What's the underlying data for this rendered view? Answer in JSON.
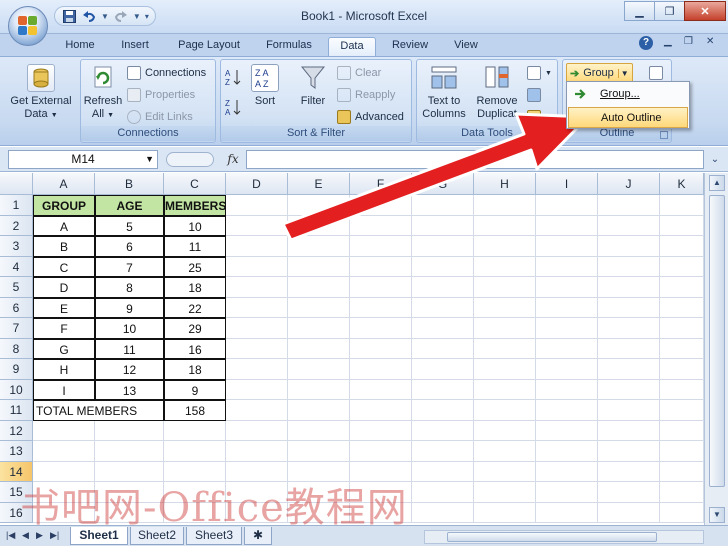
{
  "window": {
    "title": "Book1 - Microsoft Excel"
  },
  "tabs": [
    "Home",
    "Insert",
    "Page Layout",
    "Formulas",
    "Data",
    "Review",
    "View"
  ],
  "active_tab": "Data",
  "ribbon": {
    "get_external_data": {
      "line1": "Get External",
      "line2": "Data"
    },
    "refresh": {
      "line1": "Refresh",
      "line2": "All"
    },
    "connections_items": [
      "Connections",
      "Properties",
      "Edit Links"
    ],
    "connections_group": "Connections",
    "sort": "Sort",
    "filter": "Filter",
    "filter_items": [
      "Clear",
      "Reapply",
      "Advanced"
    ],
    "sort_filter_group": "Sort & Filter",
    "text_to_columns": {
      "line1": "Text to",
      "line2": "Columns"
    },
    "remove_duplicates": {
      "line1": "Remove",
      "line2": "Duplicat"
    },
    "data_tools_group": "Data Tools",
    "group_button": "Group",
    "outline_group": "Outline"
  },
  "dropdown": {
    "items": [
      "Group...",
      "Auto Outline"
    ],
    "highlighted": "Auto Outline"
  },
  "formula_bar": {
    "name_box": "M14",
    "fx": "fx",
    "formula": ""
  },
  "columns": [
    "A",
    "B",
    "C",
    "D",
    "E",
    "F",
    "G",
    "H",
    "I",
    "J",
    "K"
  ],
  "rows": [
    "1",
    "2",
    "3",
    "4",
    "5",
    "6",
    "7",
    "8",
    "9",
    "10",
    "11",
    "12",
    "13",
    "14",
    "15",
    "16"
  ],
  "selected_row": "14",
  "table": {
    "headers": [
      "GROUP",
      "AGE",
      "MEMBERS"
    ],
    "data": [
      [
        "A",
        "5",
        "10"
      ],
      [
        "B",
        "6",
        "11"
      ],
      [
        "C",
        "7",
        "25"
      ],
      [
        "D",
        "8",
        "18"
      ],
      [
        "E",
        "9",
        "22"
      ],
      [
        "F",
        "10",
        "29"
      ],
      [
        "G",
        "11",
        "16"
      ],
      [
        "H",
        "12",
        "18"
      ],
      [
        "I",
        "13",
        "9"
      ]
    ],
    "total_label": "TOTAL MEMBERS",
    "total_value": "158"
  },
  "sheets": [
    "Sheet1",
    "Sheet2",
    "Sheet3"
  ],
  "active_sheet": "Sheet1",
  "watermark": "书吧网-Office教程网",
  "colors": {
    "header_fill": "#c3e5a4",
    "arrow": "#e41f1f",
    "highlight": "#ffd87a"
  }
}
